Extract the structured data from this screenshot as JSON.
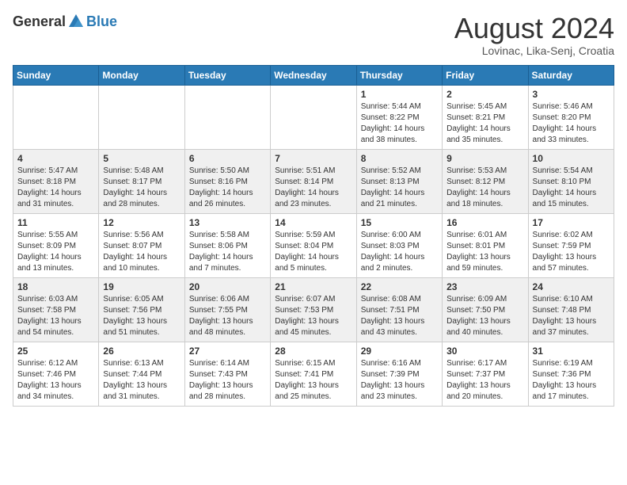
{
  "header": {
    "logo_general": "General",
    "logo_blue": "Blue",
    "month_year": "August 2024",
    "location": "Lovinac, Lika-Senj, Croatia"
  },
  "calendar": {
    "days_of_week": [
      "Sunday",
      "Monday",
      "Tuesday",
      "Wednesday",
      "Thursday",
      "Friday",
      "Saturday"
    ],
    "weeks": [
      [
        {
          "day": "",
          "info": ""
        },
        {
          "day": "",
          "info": ""
        },
        {
          "day": "",
          "info": ""
        },
        {
          "day": "",
          "info": ""
        },
        {
          "day": "1",
          "info": "Sunrise: 5:44 AM\nSunset: 8:22 PM\nDaylight: 14 hours\nand 38 minutes."
        },
        {
          "day": "2",
          "info": "Sunrise: 5:45 AM\nSunset: 8:21 PM\nDaylight: 14 hours\nand 35 minutes."
        },
        {
          "day": "3",
          "info": "Sunrise: 5:46 AM\nSunset: 8:20 PM\nDaylight: 14 hours\nand 33 minutes."
        }
      ],
      [
        {
          "day": "4",
          "info": "Sunrise: 5:47 AM\nSunset: 8:18 PM\nDaylight: 14 hours\nand 31 minutes."
        },
        {
          "day": "5",
          "info": "Sunrise: 5:48 AM\nSunset: 8:17 PM\nDaylight: 14 hours\nand 28 minutes."
        },
        {
          "day": "6",
          "info": "Sunrise: 5:50 AM\nSunset: 8:16 PM\nDaylight: 14 hours\nand 26 minutes."
        },
        {
          "day": "7",
          "info": "Sunrise: 5:51 AM\nSunset: 8:14 PM\nDaylight: 14 hours\nand 23 minutes."
        },
        {
          "day": "8",
          "info": "Sunrise: 5:52 AM\nSunset: 8:13 PM\nDaylight: 14 hours\nand 21 minutes."
        },
        {
          "day": "9",
          "info": "Sunrise: 5:53 AM\nSunset: 8:12 PM\nDaylight: 14 hours\nand 18 minutes."
        },
        {
          "day": "10",
          "info": "Sunrise: 5:54 AM\nSunset: 8:10 PM\nDaylight: 14 hours\nand 15 minutes."
        }
      ],
      [
        {
          "day": "11",
          "info": "Sunrise: 5:55 AM\nSunset: 8:09 PM\nDaylight: 14 hours\nand 13 minutes."
        },
        {
          "day": "12",
          "info": "Sunrise: 5:56 AM\nSunset: 8:07 PM\nDaylight: 14 hours\nand 10 minutes."
        },
        {
          "day": "13",
          "info": "Sunrise: 5:58 AM\nSunset: 8:06 PM\nDaylight: 14 hours\nand 7 minutes."
        },
        {
          "day": "14",
          "info": "Sunrise: 5:59 AM\nSunset: 8:04 PM\nDaylight: 14 hours\nand 5 minutes."
        },
        {
          "day": "15",
          "info": "Sunrise: 6:00 AM\nSunset: 8:03 PM\nDaylight: 14 hours\nand 2 minutes."
        },
        {
          "day": "16",
          "info": "Sunrise: 6:01 AM\nSunset: 8:01 PM\nDaylight: 13 hours\nand 59 minutes."
        },
        {
          "day": "17",
          "info": "Sunrise: 6:02 AM\nSunset: 7:59 PM\nDaylight: 13 hours\nand 57 minutes."
        }
      ],
      [
        {
          "day": "18",
          "info": "Sunrise: 6:03 AM\nSunset: 7:58 PM\nDaylight: 13 hours\nand 54 minutes."
        },
        {
          "day": "19",
          "info": "Sunrise: 6:05 AM\nSunset: 7:56 PM\nDaylight: 13 hours\nand 51 minutes."
        },
        {
          "day": "20",
          "info": "Sunrise: 6:06 AM\nSunset: 7:55 PM\nDaylight: 13 hours\nand 48 minutes."
        },
        {
          "day": "21",
          "info": "Sunrise: 6:07 AM\nSunset: 7:53 PM\nDaylight: 13 hours\nand 45 minutes."
        },
        {
          "day": "22",
          "info": "Sunrise: 6:08 AM\nSunset: 7:51 PM\nDaylight: 13 hours\nand 43 minutes."
        },
        {
          "day": "23",
          "info": "Sunrise: 6:09 AM\nSunset: 7:50 PM\nDaylight: 13 hours\nand 40 minutes."
        },
        {
          "day": "24",
          "info": "Sunrise: 6:10 AM\nSunset: 7:48 PM\nDaylight: 13 hours\nand 37 minutes."
        }
      ],
      [
        {
          "day": "25",
          "info": "Sunrise: 6:12 AM\nSunset: 7:46 PM\nDaylight: 13 hours\nand 34 minutes."
        },
        {
          "day": "26",
          "info": "Sunrise: 6:13 AM\nSunset: 7:44 PM\nDaylight: 13 hours\nand 31 minutes."
        },
        {
          "day": "27",
          "info": "Sunrise: 6:14 AM\nSunset: 7:43 PM\nDaylight: 13 hours\nand 28 minutes."
        },
        {
          "day": "28",
          "info": "Sunrise: 6:15 AM\nSunset: 7:41 PM\nDaylight: 13 hours\nand 25 minutes."
        },
        {
          "day": "29",
          "info": "Sunrise: 6:16 AM\nSunset: 7:39 PM\nDaylight: 13 hours\nand 23 minutes."
        },
        {
          "day": "30",
          "info": "Sunrise: 6:17 AM\nSunset: 7:37 PM\nDaylight: 13 hours\nand 20 minutes."
        },
        {
          "day": "31",
          "info": "Sunrise: 6:19 AM\nSunset: 7:36 PM\nDaylight: 13 hours\nand 17 minutes."
        }
      ]
    ]
  }
}
